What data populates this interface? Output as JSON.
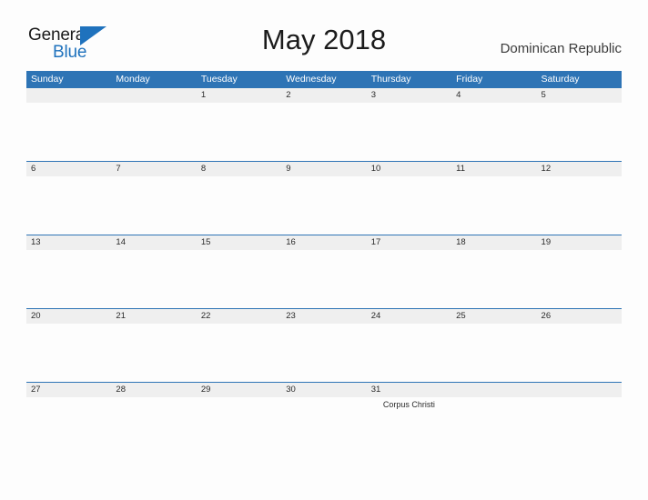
{
  "brand": {
    "word_one": "General",
    "word_two": "Blue",
    "flag_icon": "blue-triangle-flag-icon",
    "color_primary": "#1f72bd",
    "color_text": "#1b1b1b"
  },
  "header": {
    "title": "May 2018",
    "region": "Dominican Republic"
  },
  "theme": {
    "header_blue": "#2e74b5",
    "date_band": "#efefef",
    "page_background": "#fdfdfd"
  },
  "calendar": {
    "day_names": [
      "Sunday",
      "Monday",
      "Tuesday",
      "Wednesday",
      "Thursday",
      "Friday",
      "Saturday"
    ],
    "weeks": [
      {
        "days": [
          {
            "date": "",
            "event": ""
          },
          {
            "date": "",
            "event": ""
          },
          {
            "date": "1",
            "event": ""
          },
          {
            "date": "2",
            "event": ""
          },
          {
            "date": "3",
            "event": ""
          },
          {
            "date": "4",
            "event": ""
          },
          {
            "date": "5",
            "event": ""
          }
        ]
      },
      {
        "days": [
          {
            "date": "6",
            "event": ""
          },
          {
            "date": "7",
            "event": ""
          },
          {
            "date": "8",
            "event": ""
          },
          {
            "date": "9",
            "event": ""
          },
          {
            "date": "10",
            "event": ""
          },
          {
            "date": "11",
            "event": ""
          },
          {
            "date": "12",
            "event": ""
          }
        ]
      },
      {
        "days": [
          {
            "date": "13",
            "event": ""
          },
          {
            "date": "14",
            "event": ""
          },
          {
            "date": "15",
            "event": ""
          },
          {
            "date": "16",
            "event": ""
          },
          {
            "date": "17",
            "event": ""
          },
          {
            "date": "18",
            "event": ""
          },
          {
            "date": "19",
            "event": ""
          }
        ]
      },
      {
        "days": [
          {
            "date": "20",
            "event": ""
          },
          {
            "date": "21",
            "event": ""
          },
          {
            "date": "22",
            "event": ""
          },
          {
            "date": "23",
            "event": ""
          },
          {
            "date": "24",
            "event": ""
          },
          {
            "date": "25",
            "event": ""
          },
          {
            "date": "26",
            "event": ""
          }
        ]
      },
      {
        "days": [
          {
            "date": "27",
            "event": ""
          },
          {
            "date": "28",
            "event": ""
          },
          {
            "date": "29",
            "event": ""
          },
          {
            "date": "30",
            "event": ""
          },
          {
            "date": "31",
            "event": "Corpus Christi"
          },
          {
            "date": "",
            "event": ""
          },
          {
            "date": "",
            "event": ""
          }
        ]
      }
    ]
  }
}
